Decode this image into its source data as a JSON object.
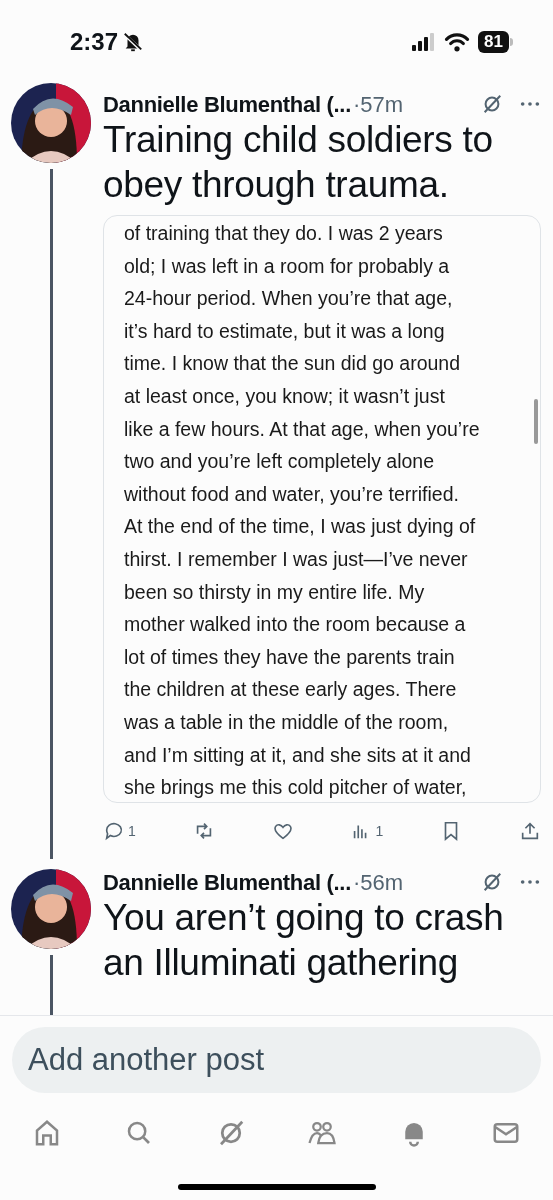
{
  "status_bar": {
    "time": "2:37",
    "battery": "81"
  },
  "posts": [
    {
      "author": "Dannielle Blumenthal (...",
      "time": "·57m",
      "title_lines": [
        "Training child soldiers to",
        "obey through trauma."
      ],
      "card_lines": [
        "of training that they do. I was 2 years",
        "old; I was left in a room for probably a",
        "24-hour period. When you’re that age,",
        "it’s hard to estimate, but it was a long",
        "time. I know that the sun did go around",
        "at least once, you know; it wasn’t just",
        "like a few hours. At that age, when you’re",
        "two and you’re left completely alone",
        "without food and water, you’re terrified.",
        "At the end of the time, I was just dying of",
        "thirst. I remember I was just—I’ve never",
        "been so thirsty in my entire life. My",
        "mother walked into the room because a",
        "lot of times they have the parents train",
        "the children at these early ages. There",
        "was a table in the middle of the room,",
        "and I’m sitting at it, and she sits at it and",
        "she brings me this cold pitcher of water,"
      ],
      "actions": [
        {
          "kind": "reply",
          "count": "1"
        },
        {
          "kind": "repost"
        },
        {
          "kind": "like"
        },
        {
          "kind": "views",
          "count": "1"
        },
        {
          "kind": "bookmark"
        },
        {
          "kind": "share"
        }
      ]
    },
    {
      "author": "Dannielle Blumenthal (...",
      "time": "·56m",
      "title_lines": [
        "You aren’t going to crash",
        "an Illuminati gathering"
      ]
    }
  ],
  "composer": {
    "placeholder": "Add another post"
  },
  "nav": [
    {
      "kind": "home",
      "selected": false
    },
    {
      "kind": "search",
      "selected": false
    },
    {
      "kind": "grok",
      "selected": false
    },
    {
      "kind": "communities",
      "selected": false
    },
    {
      "kind": "notifications",
      "selected": true
    },
    {
      "kind": "messages",
      "selected": false
    }
  ]
}
